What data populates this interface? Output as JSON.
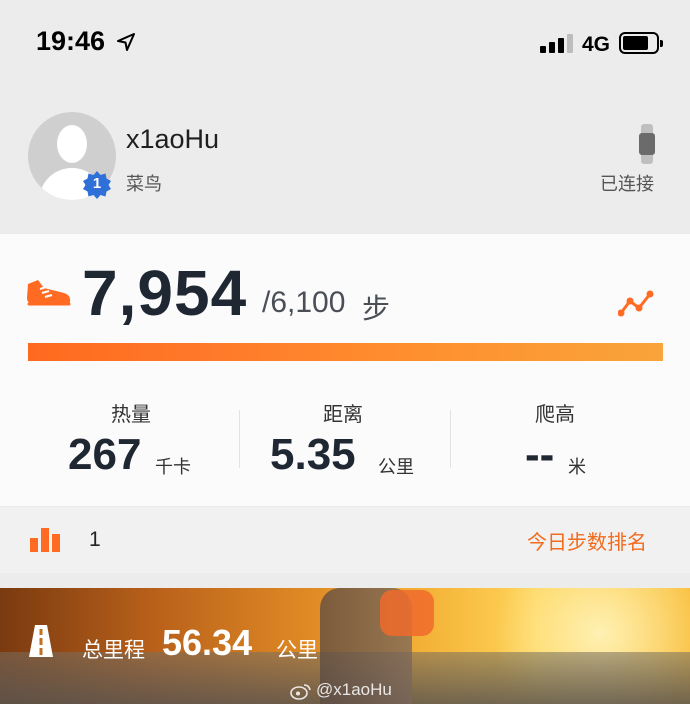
{
  "status_bar": {
    "time": "19:46",
    "network": "4G"
  },
  "profile": {
    "username": "x1aoHu",
    "level": "1",
    "rank_title": "菜鸟",
    "device_status": "已连接"
  },
  "steps": {
    "value": "7,954",
    "goal": "/6,100",
    "unit": "步",
    "progress_fraction": 1.0,
    "accent_color": "#ff6b22"
  },
  "metrics": [
    {
      "label": "热量",
      "value": "267",
      "unit": "千卡"
    },
    {
      "label": "距离",
      "value": "5.35",
      "unit": "公里"
    },
    {
      "label": "爬高",
      "value": "--",
      "unit": "米"
    }
  ],
  "ranking": {
    "value": "1",
    "link_label": "今日步数排名"
  },
  "banner": {
    "label": "总里程",
    "value": "56.34",
    "unit": "公里",
    "watermark": "@x1aoHu"
  }
}
